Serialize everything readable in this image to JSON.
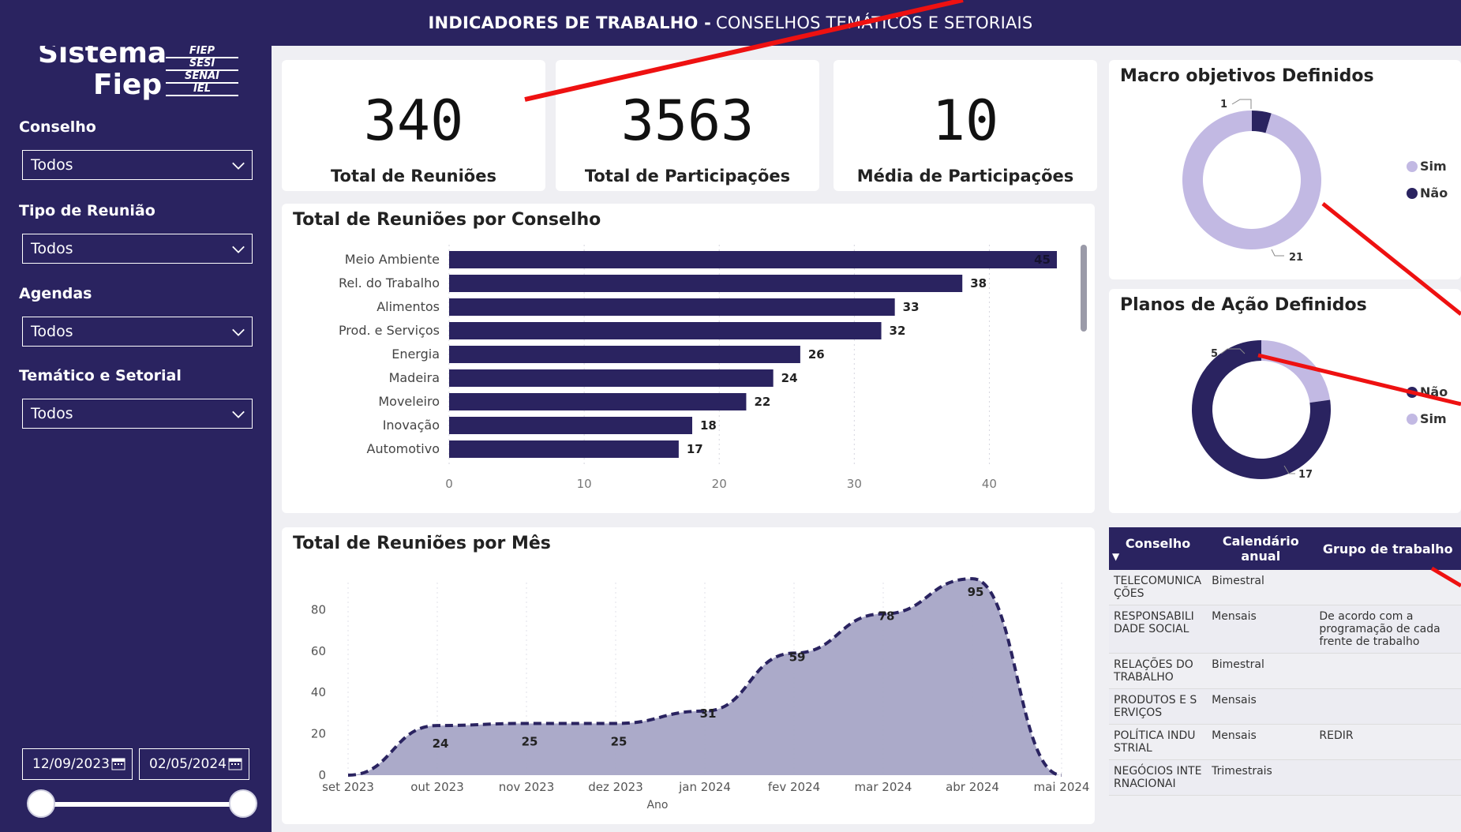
{
  "header": {
    "title_strong": "INDICADORES DE TRABALHO -",
    "title_rest": "CONSELHOS TEMÁTICOS E SETORIAIS"
  },
  "logo": {
    "main_word_1": "Sistema",
    "main_word_2": "Fiep",
    "stack": [
      "FIEP",
      "SESI",
      "SENAI",
      "IEL"
    ]
  },
  "filters": [
    {
      "label": "Conselho",
      "value": "Todos"
    },
    {
      "label": "Tipo de Reunião",
      "value": "Todos"
    },
    {
      "label": "Agendas",
      "value": "Todos"
    },
    {
      "label": "Temático e Setorial",
      "value": "Todos"
    }
  ],
  "date_range": {
    "start": "12/09/2023",
    "end": "02/05/2024"
  },
  "kpis": [
    {
      "value": "340",
      "label": "Total de Reuniões"
    },
    {
      "value": "3563",
      "label": "Total de Participações"
    },
    {
      "value": "10",
      "label": "Média de Participações"
    }
  ],
  "panels": {
    "bar_title": "Total de Reuniões por Conselho",
    "area_title": "Total de Reuniões por Mês",
    "donut1_title": "Macro objetivos Definidos",
    "donut2_title": "Planos de Ação Definidos"
  },
  "chart_data": [
    {
      "type": "bar",
      "title": "Total de Reuniões por Conselho",
      "categories": [
        "Meio Ambiente",
        "Rel. do Trabalho",
        "Alimentos",
        "Prod. e Serviços",
        "Energia",
        "Madeira",
        "Moveleiro",
        "Inovação",
        "Automotivo"
      ],
      "values": [
        45,
        38,
        33,
        32,
        26,
        24,
        22,
        18,
        17
      ],
      "xlim": [
        0,
        45
      ],
      "xticks": [
        "0",
        "10",
        "20",
        "30",
        "40"
      ],
      "bar_color": "#2a2360"
    },
    {
      "type": "area",
      "title": "Total de Reuniões por Mês",
      "categories": [
        "set 2023",
        "out 2023",
        "nov 2023",
        "dez 2023",
        "jan 2024",
        "fev 2024",
        "mar 2024",
        "abr 2024",
        "mai 2024"
      ],
      "values": [
        0,
        24,
        25,
        25,
        31,
        59,
        78,
        95,
        0
      ],
      "labels": [
        "",
        "24",
        "25",
        "25",
        "31",
        "59",
        "78",
        "95",
        ""
      ],
      "xlabel": "Ano",
      "ylim": [
        0,
        100
      ],
      "yticks": [
        "0",
        "20",
        "40",
        "60",
        "80"
      ],
      "fill_color": "#a7a5c6",
      "line_color": "#2a2360"
    },
    {
      "type": "pie",
      "title": "Macro objetivos Definidos",
      "series": [
        {
          "name": "Sim",
          "value": 21,
          "color": "#c2b9e3"
        },
        {
          "name": "Não",
          "value": 1,
          "color": "#2a2360"
        }
      ],
      "labels": [
        "21",
        "1"
      ],
      "legend": [
        "Sim",
        "Não"
      ]
    },
    {
      "type": "pie",
      "title": "Planos de Ação Definidos",
      "series": [
        {
          "name": "Não",
          "value": 17,
          "color": "#2a2360"
        },
        {
          "name": "Sim",
          "value": 5,
          "color": "#c2b9e3"
        }
      ],
      "labels": [
        "17",
        "5"
      ],
      "legend": [
        "Não",
        "Sim"
      ]
    }
  ],
  "table": {
    "headers": [
      "Conselho",
      "Calendário anual",
      "Grupo de trabalho"
    ],
    "rows": [
      [
        "TELECOMUNICAÇÕES",
        "Bimestral",
        ""
      ],
      [
        "RESPONSABILIDADE SOCIAL",
        "Mensais",
        "De acordo com a programação de cada frente de trabalho"
      ],
      [
        "RELAÇÕES DO TRABALHO",
        "Bimestral",
        ""
      ],
      [
        "PRODUTOS E SERVIÇOS",
        "Mensais",
        ""
      ],
      [
        "POLÍTICA INDUSTRIAL",
        "Mensais",
        "REDIR"
      ],
      [
        "NEGÓCIOS INTERNACIONAI",
        "Trimestrais",
        ""
      ]
    ]
  }
}
